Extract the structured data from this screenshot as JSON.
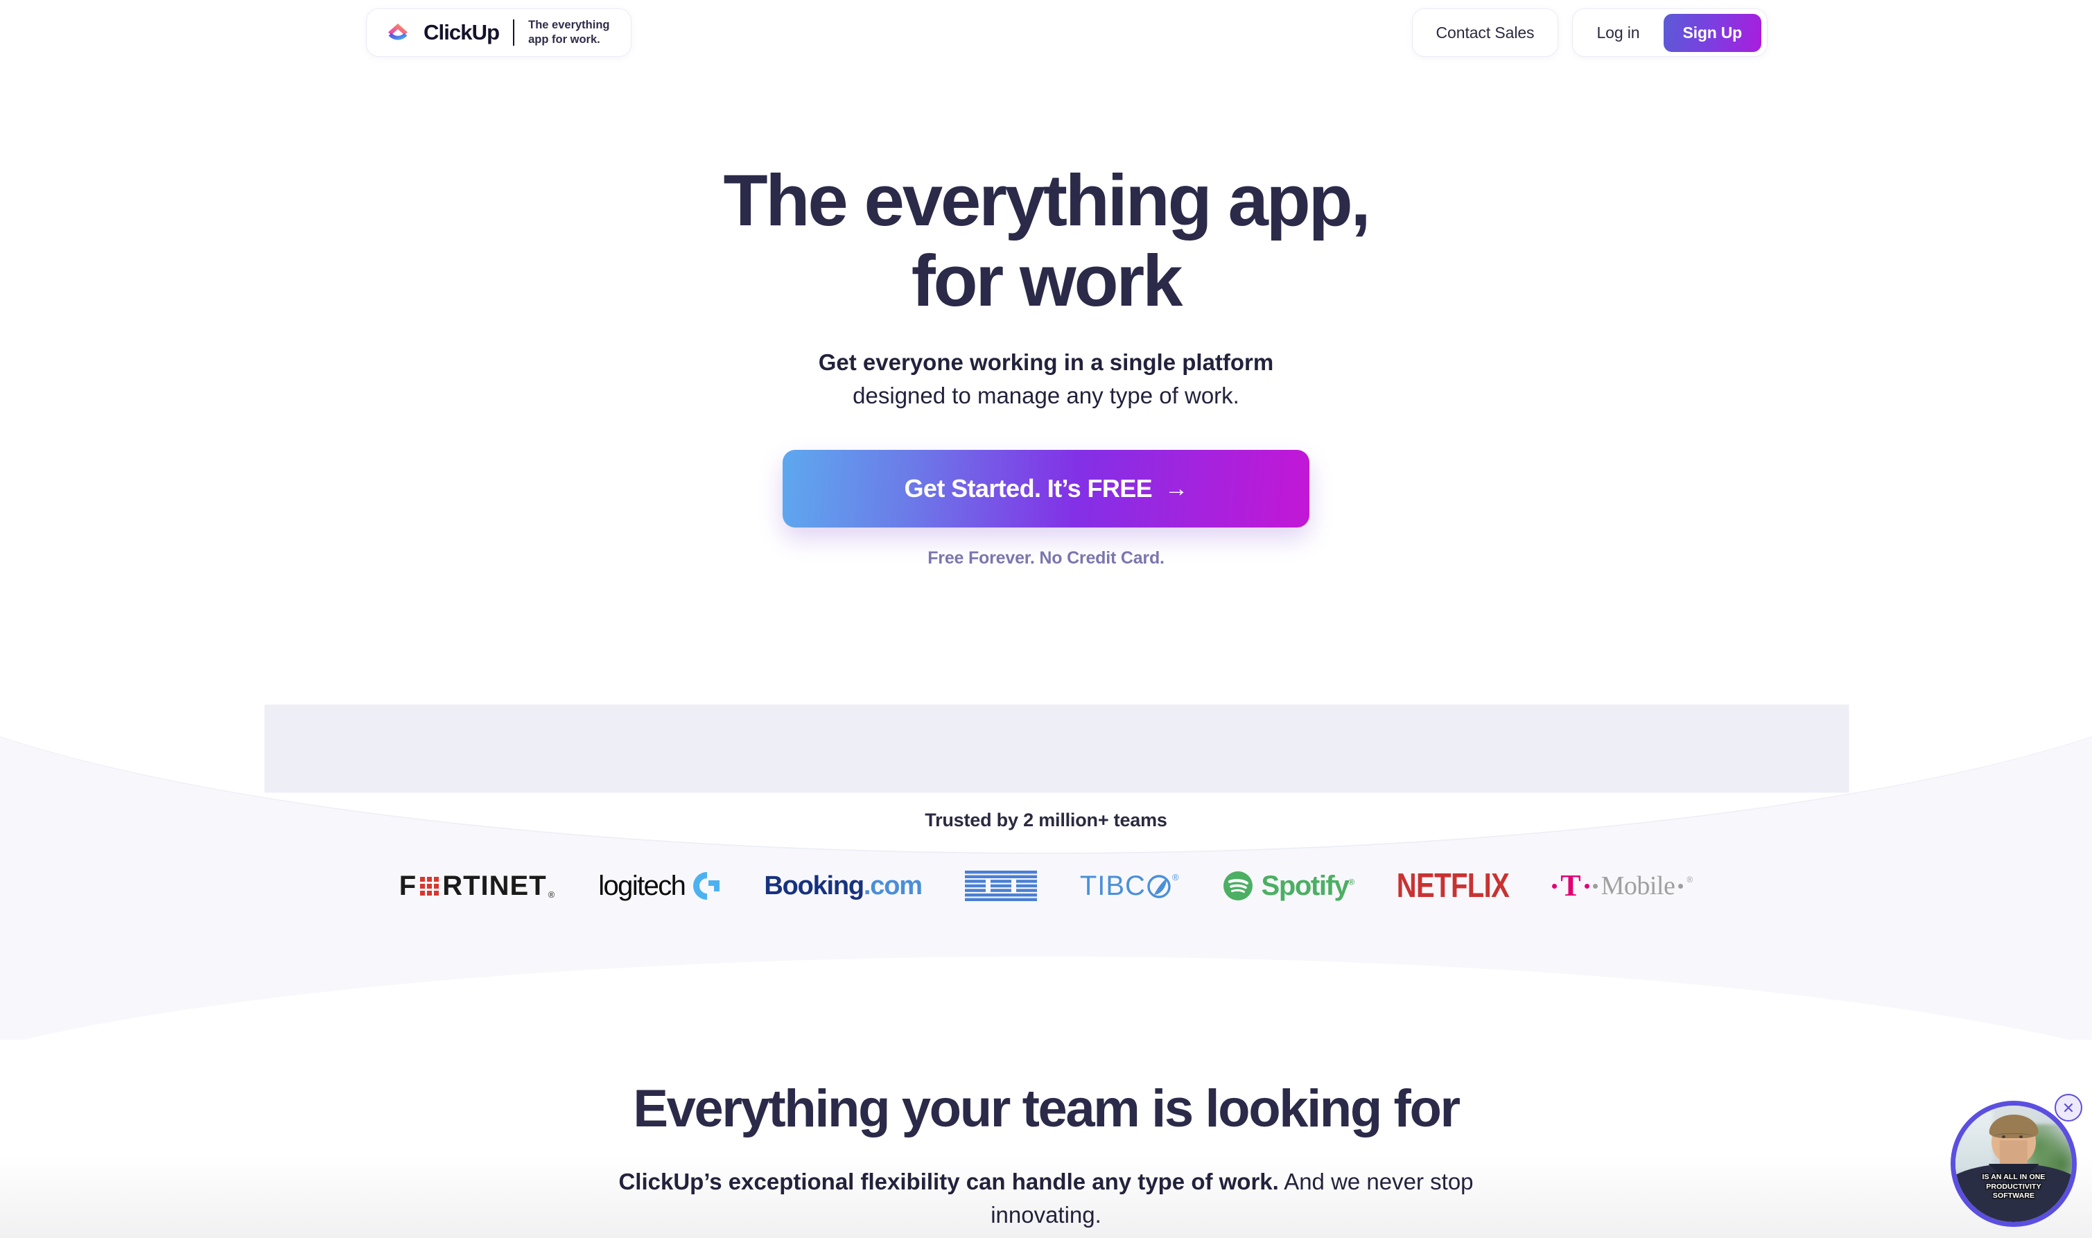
{
  "header": {
    "logo": {
      "mark_icon": "clickup-logo-icon",
      "wordmark": "ClickUp",
      "tagline": "The everything\napp for work."
    },
    "contact_sales_label": "Contact Sales",
    "login_label": "Log in",
    "signup_label": "Sign Up"
  },
  "hero": {
    "headline_line1": "The everything app,",
    "headline_line2": "for work",
    "sub_bold": "Get everyone working in a single platform",
    "sub_regular": "designed to manage any type of work.",
    "cta_label": "Get Started. It’s FREE",
    "cta_arrow": "→",
    "cta_note": "Free Forever. No Credit Card."
  },
  "trusted": {
    "label": "Trusted by 2 million+ teams",
    "logos": [
      {
        "name": "fortinet",
        "text": "FORTINET",
        "prefix": "F",
        "suffix": "RTINET",
        "registered": "®",
        "color": "#1b1b1b",
        "accent": "#d7382f"
      },
      {
        "name": "logitech",
        "text": "logitech",
        "color": "#0c0c0c",
        "accent": "#4db1ef"
      },
      {
        "name": "booking-com",
        "text": "Booking",
        "suffix": ".com",
        "color": "#17327f",
        "accent": "#4a8ed8"
      },
      {
        "name": "ibm",
        "text": "IBM",
        "color": "#4a7fd4"
      },
      {
        "name": "tibco",
        "text": "TIBC",
        "registered": "®",
        "color": "#4a90d9"
      },
      {
        "name": "spotify",
        "text": "Spotify",
        "registered": "®",
        "color": "#4caf63"
      },
      {
        "name": "netflix",
        "text": "NETFLIX",
        "color": "#c93232"
      },
      {
        "name": "t-mobile",
        "text": "Mobile",
        "prefix": "T",
        "registered": "®",
        "color": "#a0a0a0",
        "accent": "#e20074"
      }
    ]
  },
  "section_two": {
    "heading": "Everything your team is looking for",
    "body_bold": "ClickUp’s exceptional flexibility can handle any type of work.",
    "body_regular": " And we never stop innovating."
  },
  "video_widget": {
    "caption": "IS AN ALL IN ONE PRODUCTIVITY SOFTWARE",
    "close_icon": "close-icon",
    "ring_color": "#5b4fe0"
  },
  "colors": {
    "headline": "#2b2a49",
    "accent_purple": "#7b3fe0",
    "accent_magenta": "#c317d6",
    "note_purple": "#7b76ad",
    "lavender_bg": "#f8f8fc"
  }
}
